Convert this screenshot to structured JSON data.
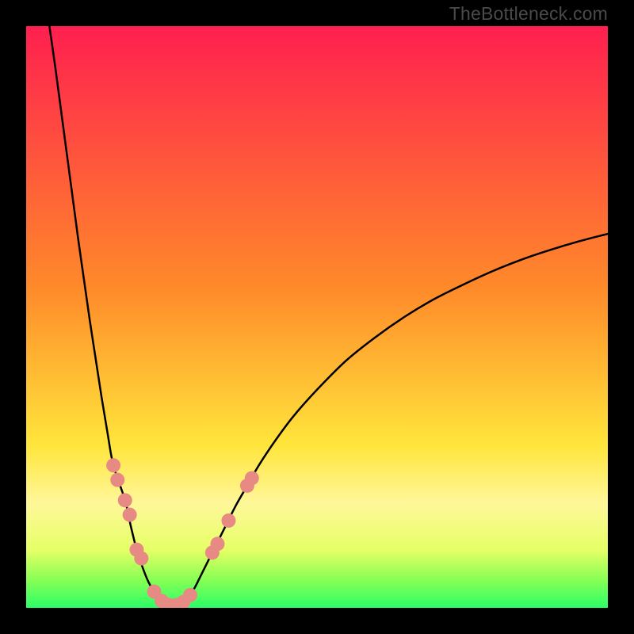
{
  "watermark": "TheBottleneck.com",
  "chart_data": {
    "type": "line",
    "title": "",
    "xlabel": "",
    "ylabel": "",
    "xlim": [
      0,
      100
    ],
    "ylim": [
      0,
      100
    ],
    "background_gradient": {
      "stops": [
        {
          "offset": 0.0,
          "color": "#ff1f4f"
        },
        {
          "offset": 0.45,
          "color": "#ff8a2a"
        },
        {
          "offset": 0.72,
          "color": "#ffe53b"
        },
        {
          "offset": 0.82,
          "color": "#fff79a"
        },
        {
          "offset": 0.9,
          "color": "#e6ff66"
        },
        {
          "offset": 0.95,
          "color": "#8bff55"
        },
        {
          "offset": 1.0,
          "color": "#2bff66"
        }
      ]
    },
    "series": [
      {
        "name": "left-branch",
        "type": "line",
        "color": "#000000",
        "width": 2.5,
        "points": [
          {
            "x": 4.0,
            "y": 100.0
          },
          {
            "x": 5.0,
            "y": 93.0
          },
          {
            "x": 6.0,
            "y": 85.5
          },
          {
            "x": 7.0,
            "y": 78.0
          },
          {
            "x": 8.0,
            "y": 70.5
          },
          {
            "x": 9.0,
            "y": 63.0
          },
          {
            "x": 10.0,
            "y": 56.0
          },
          {
            "x": 11.0,
            "y": 49.0
          },
          {
            "x": 12.0,
            "y": 42.5
          },
          {
            "x": 13.0,
            "y": 36.0
          },
          {
            "x": 14.0,
            "y": 30.0
          },
          {
            "x": 15.0,
            "y": 24.5
          },
          {
            "x": 17.0,
            "y": 18.5
          },
          {
            "x": 18.0,
            "y": 14.0
          },
          {
            "x": 19.0,
            "y": 10.0
          },
          {
            "x": 20.0,
            "y": 7.0
          },
          {
            "x": 21.0,
            "y": 4.5
          },
          {
            "x": 22.0,
            "y": 2.8
          },
          {
            "x": 23.0,
            "y": 1.5
          },
          {
            "x": 24.0,
            "y": 0.8
          },
          {
            "x": 25.0,
            "y": 0.4
          }
        ]
      },
      {
        "name": "right-branch",
        "type": "line",
        "color": "#000000",
        "width": 2.5,
        "points": [
          {
            "x": 25.0,
            "y": 0.4
          },
          {
            "x": 26.0,
            "y": 0.5
          },
          {
            "x": 27.0,
            "y": 1.0
          },
          {
            "x": 28.0,
            "y": 2.0
          },
          {
            "x": 29.0,
            "y": 3.5
          },
          {
            "x": 30.0,
            "y": 5.5
          },
          {
            "x": 32.0,
            "y": 9.5
          },
          {
            "x": 34.0,
            "y": 13.5
          },
          {
            "x": 36.0,
            "y": 17.5
          },
          {
            "x": 38.0,
            "y": 21.0
          },
          {
            "x": 40.0,
            "y": 24.5
          },
          {
            "x": 43.0,
            "y": 29.0
          },
          {
            "x": 46.0,
            "y": 33.0
          },
          {
            "x": 50.0,
            "y": 37.5
          },
          {
            "x": 55.0,
            "y": 42.5
          },
          {
            "x": 60.0,
            "y": 46.5
          },
          {
            "x": 65.0,
            "y": 50.0
          },
          {
            "x": 70.0,
            "y": 53.0
          },
          {
            "x": 75.0,
            "y": 55.5
          },
          {
            "x": 80.0,
            "y": 57.8
          },
          {
            "x": 85.0,
            "y": 59.8
          },
          {
            "x": 90.0,
            "y": 61.5
          },
          {
            "x": 95.0,
            "y": 63.0
          },
          {
            "x": 100.0,
            "y": 64.3
          }
        ]
      }
    ],
    "markers": {
      "name": "highlight-dots",
      "type": "scatter",
      "color": "#e88a84",
      "radius": 9,
      "points": [
        {
          "x": 15.0,
          "y": 24.5
        },
        {
          "x": 15.7,
          "y": 22.0
        },
        {
          "x": 17.0,
          "y": 18.5
        },
        {
          "x": 17.8,
          "y": 16.0
        },
        {
          "x": 19.0,
          "y": 10.0
        },
        {
          "x": 19.8,
          "y": 8.5
        },
        {
          "x": 22.0,
          "y": 2.8
        },
        {
          "x": 23.3,
          "y": 1.2
        },
        {
          "x": 24.5,
          "y": 0.5
        },
        {
          "x": 25.8,
          "y": 0.5
        },
        {
          "x": 27.0,
          "y": 1.0
        },
        {
          "x": 28.2,
          "y": 2.2
        },
        {
          "x": 32.0,
          "y": 9.5
        },
        {
          "x": 32.9,
          "y": 11.0
        },
        {
          "x": 34.8,
          "y": 15.0
        },
        {
          "x": 38.0,
          "y": 21.0
        },
        {
          "x": 38.8,
          "y": 22.3
        }
      ]
    }
  }
}
